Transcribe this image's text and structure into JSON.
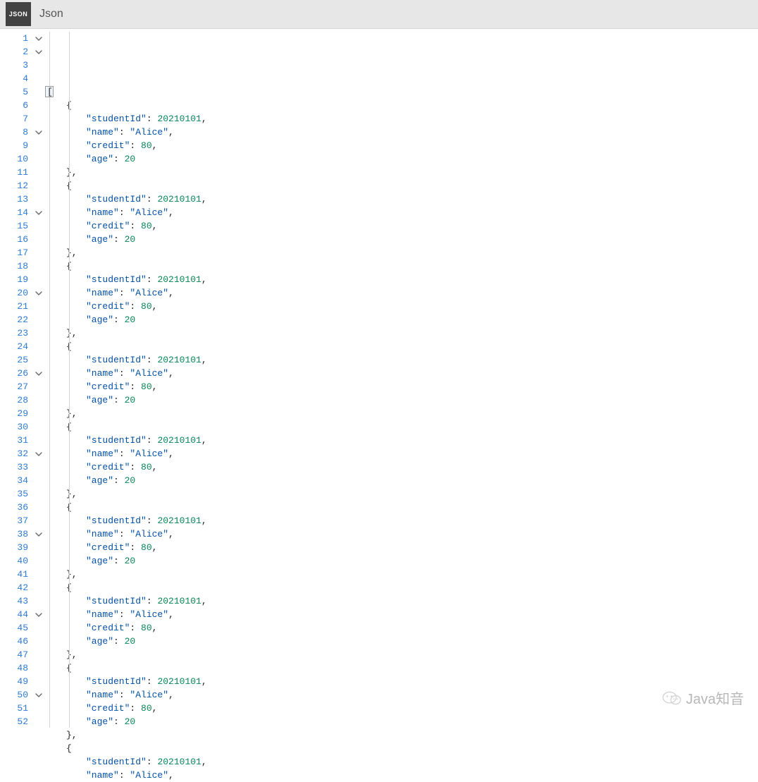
{
  "header": {
    "icon_label": "JSON",
    "title": "Json"
  },
  "watermark": {
    "text": "Java知音"
  },
  "editor": {
    "lines": [
      {
        "n": 1,
        "fold": true,
        "ind": 1,
        "tokens": [
          {
            "t": "cursor",
            "v": "["
          }
        ]
      },
      {
        "n": 2,
        "fold": true,
        "ind": 2,
        "tokens": [
          {
            "t": "punc",
            "v": "{"
          }
        ]
      },
      {
        "n": 3,
        "fold": false,
        "ind": 3,
        "tokens": [
          {
            "t": "key",
            "v": "\"studentId\""
          },
          {
            "t": "punc",
            "v": ": "
          },
          {
            "t": "num",
            "v": "20210101"
          },
          {
            "t": "punc",
            "v": ","
          }
        ]
      },
      {
        "n": 4,
        "fold": false,
        "ind": 3,
        "tokens": [
          {
            "t": "key",
            "v": "\"name\""
          },
          {
            "t": "punc",
            "v": ": "
          },
          {
            "t": "str",
            "v": "\"Alice\""
          },
          {
            "t": "punc",
            "v": ","
          }
        ]
      },
      {
        "n": 5,
        "fold": false,
        "ind": 3,
        "tokens": [
          {
            "t": "key",
            "v": "\"credit\""
          },
          {
            "t": "punc",
            "v": ": "
          },
          {
            "t": "num",
            "v": "80"
          },
          {
            "t": "punc",
            "v": ","
          }
        ]
      },
      {
        "n": 6,
        "fold": false,
        "ind": 3,
        "tokens": [
          {
            "t": "key",
            "v": "\"age\""
          },
          {
            "t": "punc",
            "v": ": "
          },
          {
            "t": "num",
            "v": "20"
          }
        ]
      },
      {
        "n": 7,
        "fold": false,
        "ind": 2,
        "tokens": [
          {
            "t": "punc",
            "v": "},"
          }
        ]
      },
      {
        "n": 8,
        "fold": true,
        "ind": 2,
        "tokens": [
          {
            "t": "punc",
            "v": "{"
          }
        ]
      },
      {
        "n": 9,
        "fold": false,
        "ind": 3,
        "tokens": [
          {
            "t": "key",
            "v": "\"studentId\""
          },
          {
            "t": "punc",
            "v": ": "
          },
          {
            "t": "num",
            "v": "20210101"
          },
          {
            "t": "punc",
            "v": ","
          }
        ]
      },
      {
        "n": 10,
        "fold": false,
        "ind": 3,
        "tokens": [
          {
            "t": "key",
            "v": "\"name\""
          },
          {
            "t": "punc",
            "v": ": "
          },
          {
            "t": "str",
            "v": "\"Alice\""
          },
          {
            "t": "punc",
            "v": ","
          }
        ]
      },
      {
        "n": 11,
        "fold": false,
        "ind": 3,
        "tokens": [
          {
            "t": "key",
            "v": "\"credit\""
          },
          {
            "t": "punc",
            "v": ": "
          },
          {
            "t": "num",
            "v": "80"
          },
          {
            "t": "punc",
            "v": ","
          }
        ]
      },
      {
        "n": 12,
        "fold": false,
        "ind": 3,
        "tokens": [
          {
            "t": "key",
            "v": "\"age\""
          },
          {
            "t": "punc",
            "v": ": "
          },
          {
            "t": "num",
            "v": "20"
          }
        ]
      },
      {
        "n": 13,
        "fold": false,
        "ind": 2,
        "tokens": [
          {
            "t": "punc",
            "v": "},"
          }
        ]
      },
      {
        "n": 14,
        "fold": true,
        "ind": 2,
        "tokens": [
          {
            "t": "punc",
            "v": "{"
          }
        ]
      },
      {
        "n": 15,
        "fold": false,
        "ind": 3,
        "tokens": [
          {
            "t": "key",
            "v": "\"studentId\""
          },
          {
            "t": "punc",
            "v": ": "
          },
          {
            "t": "num",
            "v": "20210101"
          },
          {
            "t": "punc",
            "v": ","
          }
        ]
      },
      {
        "n": 16,
        "fold": false,
        "ind": 3,
        "tokens": [
          {
            "t": "key",
            "v": "\"name\""
          },
          {
            "t": "punc",
            "v": ": "
          },
          {
            "t": "str",
            "v": "\"Alice\""
          },
          {
            "t": "punc",
            "v": ","
          }
        ]
      },
      {
        "n": 17,
        "fold": false,
        "ind": 3,
        "tokens": [
          {
            "t": "key",
            "v": "\"credit\""
          },
          {
            "t": "punc",
            "v": ": "
          },
          {
            "t": "num",
            "v": "80"
          },
          {
            "t": "punc",
            "v": ","
          }
        ]
      },
      {
        "n": 18,
        "fold": false,
        "ind": 3,
        "tokens": [
          {
            "t": "key",
            "v": "\"age\""
          },
          {
            "t": "punc",
            "v": ": "
          },
          {
            "t": "num",
            "v": "20"
          }
        ]
      },
      {
        "n": 19,
        "fold": false,
        "ind": 2,
        "tokens": [
          {
            "t": "punc",
            "v": "},"
          }
        ]
      },
      {
        "n": 20,
        "fold": true,
        "ind": 2,
        "tokens": [
          {
            "t": "punc",
            "v": "{"
          }
        ]
      },
      {
        "n": 21,
        "fold": false,
        "ind": 3,
        "tokens": [
          {
            "t": "key",
            "v": "\"studentId\""
          },
          {
            "t": "punc",
            "v": ": "
          },
          {
            "t": "num",
            "v": "20210101"
          },
          {
            "t": "punc",
            "v": ","
          }
        ]
      },
      {
        "n": 22,
        "fold": false,
        "ind": 3,
        "tokens": [
          {
            "t": "key",
            "v": "\"name\""
          },
          {
            "t": "punc",
            "v": ": "
          },
          {
            "t": "str",
            "v": "\"Alice\""
          },
          {
            "t": "punc",
            "v": ","
          }
        ]
      },
      {
        "n": 23,
        "fold": false,
        "ind": 3,
        "tokens": [
          {
            "t": "key",
            "v": "\"credit\""
          },
          {
            "t": "punc",
            "v": ": "
          },
          {
            "t": "num",
            "v": "80"
          },
          {
            "t": "punc",
            "v": ","
          }
        ]
      },
      {
        "n": 24,
        "fold": false,
        "ind": 3,
        "tokens": [
          {
            "t": "key",
            "v": "\"age\""
          },
          {
            "t": "punc",
            "v": ": "
          },
          {
            "t": "num",
            "v": "20"
          }
        ]
      },
      {
        "n": 25,
        "fold": false,
        "ind": 2,
        "tokens": [
          {
            "t": "punc",
            "v": "},"
          }
        ]
      },
      {
        "n": 26,
        "fold": true,
        "ind": 2,
        "tokens": [
          {
            "t": "punc",
            "v": "{"
          }
        ]
      },
      {
        "n": 27,
        "fold": false,
        "ind": 3,
        "tokens": [
          {
            "t": "key",
            "v": "\"studentId\""
          },
          {
            "t": "punc",
            "v": ": "
          },
          {
            "t": "num",
            "v": "20210101"
          },
          {
            "t": "punc",
            "v": ","
          }
        ]
      },
      {
        "n": 28,
        "fold": false,
        "ind": 3,
        "tokens": [
          {
            "t": "key",
            "v": "\"name\""
          },
          {
            "t": "punc",
            "v": ": "
          },
          {
            "t": "str",
            "v": "\"Alice\""
          },
          {
            "t": "punc",
            "v": ","
          }
        ]
      },
      {
        "n": 29,
        "fold": false,
        "ind": 3,
        "tokens": [
          {
            "t": "key",
            "v": "\"credit\""
          },
          {
            "t": "punc",
            "v": ": "
          },
          {
            "t": "num",
            "v": "80"
          },
          {
            "t": "punc",
            "v": ","
          }
        ]
      },
      {
        "n": 30,
        "fold": false,
        "ind": 3,
        "tokens": [
          {
            "t": "key",
            "v": "\"age\""
          },
          {
            "t": "punc",
            "v": ": "
          },
          {
            "t": "num",
            "v": "20"
          }
        ]
      },
      {
        "n": 31,
        "fold": false,
        "ind": 2,
        "tokens": [
          {
            "t": "punc",
            "v": "},"
          }
        ]
      },
      {
        "n": 32,
        "fold": true,
        "ind": 2,
        "tokens": [
          {
            "t": "punc",
            "v": "{"
          }
        ]
      },
      {
        "n": 33,
        "fold": false,
        "ind": 3,
        "tokens": [
          {
            "t": "key",
            "v": "\"studentId\""
          },
          {
            "t": "punc",
            "v": ": "
          },
          {
            "t": "num",
            "v": "20210101"
          },
          {
            "t": "punc",
            "v": ","
          }
        ]
      },
      {
        "n": 34,
        "fold": false,
        "ind": 3,
        "tokens": [
          {
            "t": "key",
            "v": "\"name\""
          },
          {
            "t": "punc",
            "v": ": "
          },
          {
            "t": "str",
            "v": "\"Alice\""
          },
          {
            "t": "punc",
            "v": ","
          }
        ]
      },
      {
        "n": 35,
        "fold": false,
        "ind": 3,
        "tokens": [
          {
            "t": "key",
            "v": "\"credit\""
          },
          {
            "t": "punc",
            "v": ": "
          },
          {
            "t": "num",
            "v": "80"
          },
          {
            "t": "punc",
            "v": ","
          }
        ]
      },
      {
        "n": 36,
        "fold": false,
        "ind": 3,
        "tokens": [
          {
            "t": "key",
            "v": "\"age\""
          },
          {
            "t": "punc",
            "v": ": "
          },
          {
            "t": "num",
            "v": "20"
          }
        ]
      },
      {
        "n": 37,
        "fold": false,
        "ind": 2,
        "tokens": [
          {
            "t": "punc",
            "v": "},"
          }
        ]
      },
      {
        "n": 38,
        "fold": true,
        "ind": 2,
        "tokens": [
          {
            "t": "punc",
            "v": "{"
          }
        ]
      },
      {
        "n": 39,
        "fold": false,
        "ind": 3,
        "tokens": [
          {
            "t": "key",
            "v": "\"studentId\""
          },
          {
            "t": "punc",
            "v": ": "
          },
          {
            "t": "num",
            "v": "20210101"
          },
          {
            "t": "punc",
            "v": ","
          }
        ]
      },
      {
        "n": 40,
        "fold": false,
        "ind": 3,
        "tokens": [
          {
            "t": "key",
            "v": "\"name\""
          },
          {
            "t": "punc",
            "v": ": "
          },
          {
            "t": "str",
            "v": "\"Alice\""
          },
          {
            "t": "punc",
            "v": ","
          }
        ]
      },
      {
        "n": 41,
        "fold": false,
        "ind": 3,
        "tokens": [
          {
            "t": "key",
            "v": "\"credit\""
          },
          {
            "t": "punc",
            "v": ": "
          },
          {
            "t": "num",
            "v": "80"
          },
          {
            "t": "punc",
            "v": ","
          }
        ]
      },
      {
        "n": 42,
        "fold": false,
        "ind": 3,
        "tokens": [
          {
            "t": "key",
            "v": "\"age\""
          },
          {
            "t": "punc",
            "v": ": "
          },
          {
            "t": "num",
            "v": "20"
          }
        ]
      },
      {
        "n": 43,
        "fold": false,
        "ind": 2,
        "tokens": [
          {
            "t": "punc",
            "v": "},"
          }
        ]
      },
      {
        "n": 44,
        "fold": true,
        "ind": 2,
        "tokens": [
          {
            "t": "punc",
            "v": "{"
          }
        ]
      },
      {
        "n": 45,
        "fold": false,
        "ind": 3,
        "tokens": [
          {
            "t": "key",
            "v": "\"studentId\""
          },
          {
            "t": "punc",
            "v": ": "
          },
          {
            "t": "num",
            "v": "20210101"
          },
          {
            "t": "punc",
            "v": ","
          }
        ]
      },
      {
        "n": 46,
        "fold": false,
        "ind": 3,
        "tokens": [
          {
            "t": "key",
            "v": "\"name\""
          },
          {
            "t": "punc",
            "v": ": "
          },
          {
            "t": "str",
            "v": "\"Alice\""
          },
          {
            "t": "punc",
            "v": ","
          }
        ]
      },
      {
        "n": 47,
        "fold": false,
        "ind": 3,
        "tokens": [
          {
            "t": "key",
            "v": "\"credit\""
          },
          {
            "t": "punc",
            "v": ": "
          },
          {
            "t": "num",
            "v": "80"
          },
          {
            "t": "punc",
            "v": ","
          }
        ]
      },
      {
        "n": 48,
        "fold": false,
        "ind": 3,
        "tokens": [
          {
            "t": "key",
            "v": "\"age\""
          },
          {
            "t": "punc",
            "v": ": "
          },
          {
            "t": "num",
            "v": "20"
          }
        ]
      },
      {
        "n": 49,
        "fold": false,
        "ind": 2,
        "tokens": [
          {
            "t": "punc",
            "v": "},"
          }
        ]
      },
      {
        "n": 50,
        "fold": true,
        "ind": 2,
        "tokens": [
          {
            "t": "punc",
            "v": "{"
          }
        ]
      },
      {
        "n": 51,
        "fold": false,
        "ind": 3,
        "tokens": [
          {
            "t": "key",
            "v": "\"studentId\""
          },
          {
            "t": "punc",
            "v": ": "
          },
          {
            "t": "num",
            "v": "20210101"
          },
          {
            "t": "punc",
            "v": ","
          }
        ]
      },
      {
        "n": 52,
        "fold": false,
        "ind": 3,
        "tokens": [
          {
            "t": "key",
            "v": "\"name\""
          },
          {
            "t": "punc",
            "v": ": "
          },
          {
            "t": "str",
            "v": "\"Alice\""
          },
          {
            "t": "punc",
            "v": ","
          }
        ]
      }
    ]
  }
}
